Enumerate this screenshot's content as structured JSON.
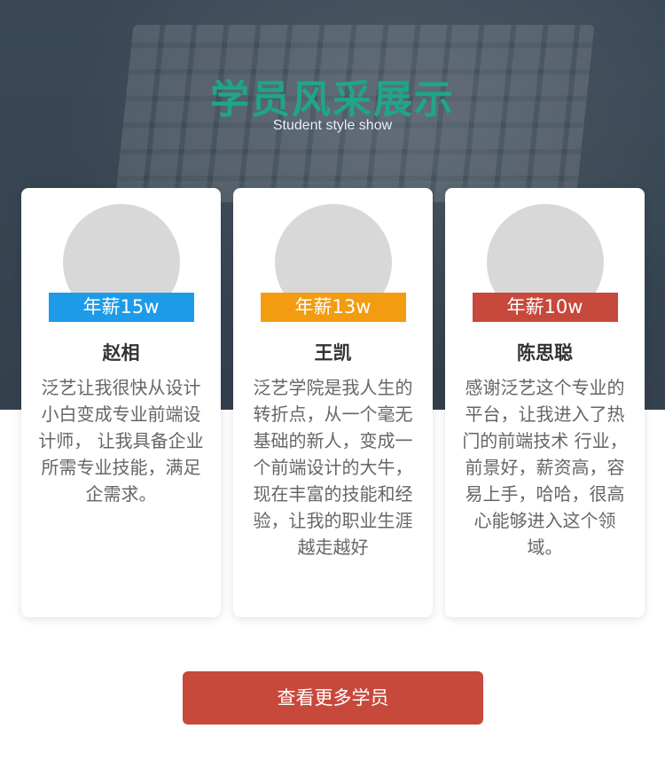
{
  "header": {
    "title": "学员风采展示",
    "subtitle": "Student style show"
  },
  "colors": {
    "title": "#1fa58a",
    "hero_bg": "#3d4c5a",
    "button": "#c7493b"
  },
  "students": [
    {
      "salary": "年薪15w",
      "salary_color": "#1e9be8",
      "name": "赵相",
      "desc": "泛艺让我很快从设计小白变成专业前端设计师， 让我具备企业所需专业技能，满足企需求。"
    },
    {
      "salary": "年薪13w",
      "salary_color": "#f39c12",
      "name": "王凯",
      "desc": "泛艺学院是我人生的转折点，从一个毫无基础的新人，变成一个前端设计的大牛， 现在丰富的技能和经验，让我的职业生涯越走越好"
    },
    {
      "salary": "年薪10w",
      "salary_color": "#c7493b",
      "name": "陈思聪",
      "desc": "感谢泛艺这个专业的平台，让我进入了热门的前端技术 行业， 前景好，薪资高，容易上手，哈哈，很高心能够进入这个领域。"
    }
  ],
  "more_button": "查看更多学员"
}
